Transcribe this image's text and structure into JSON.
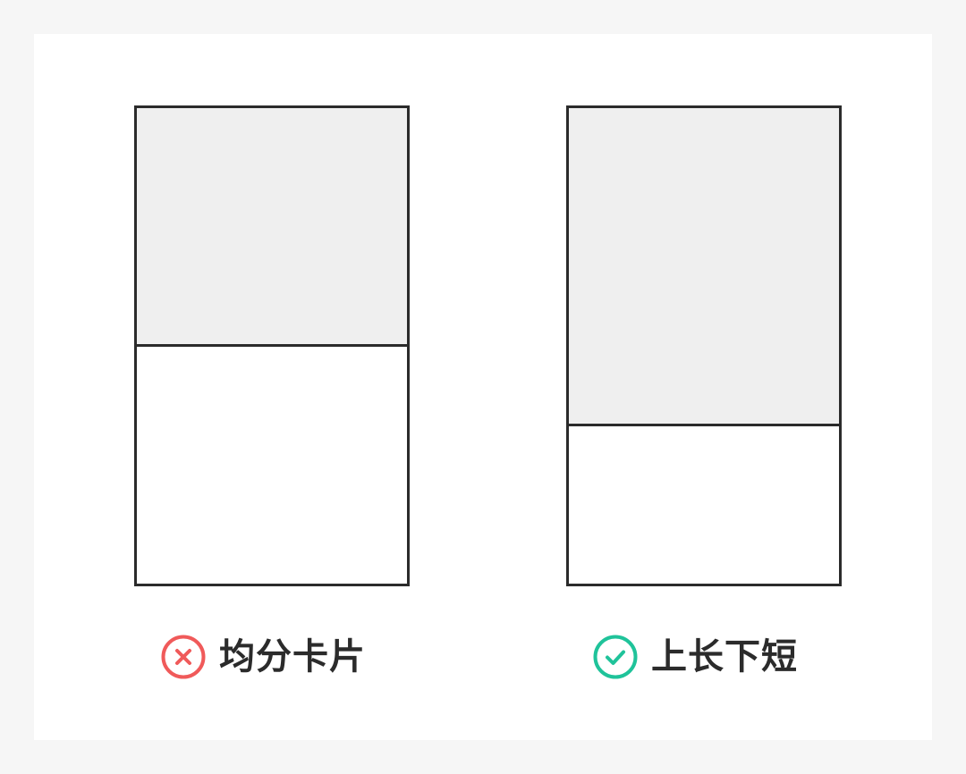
{
  "comparison": {
    "wrong": {
      "label": "均分卡片",
      "icon": "x-circle-icon",
      "icon_color": "#f05a5a"
    },
    "right": {
      "label": "上长下短",
      "icon": "check-circle-icon",
      "icon_color": "#1fc39a"
    }
  },
  "colors": {
    "background": "#f6f6f6",
    "canvas": "#ffffff",
    "stroke": "#2b2b2b",
    "top_fill": "#efefef"
  }
}
